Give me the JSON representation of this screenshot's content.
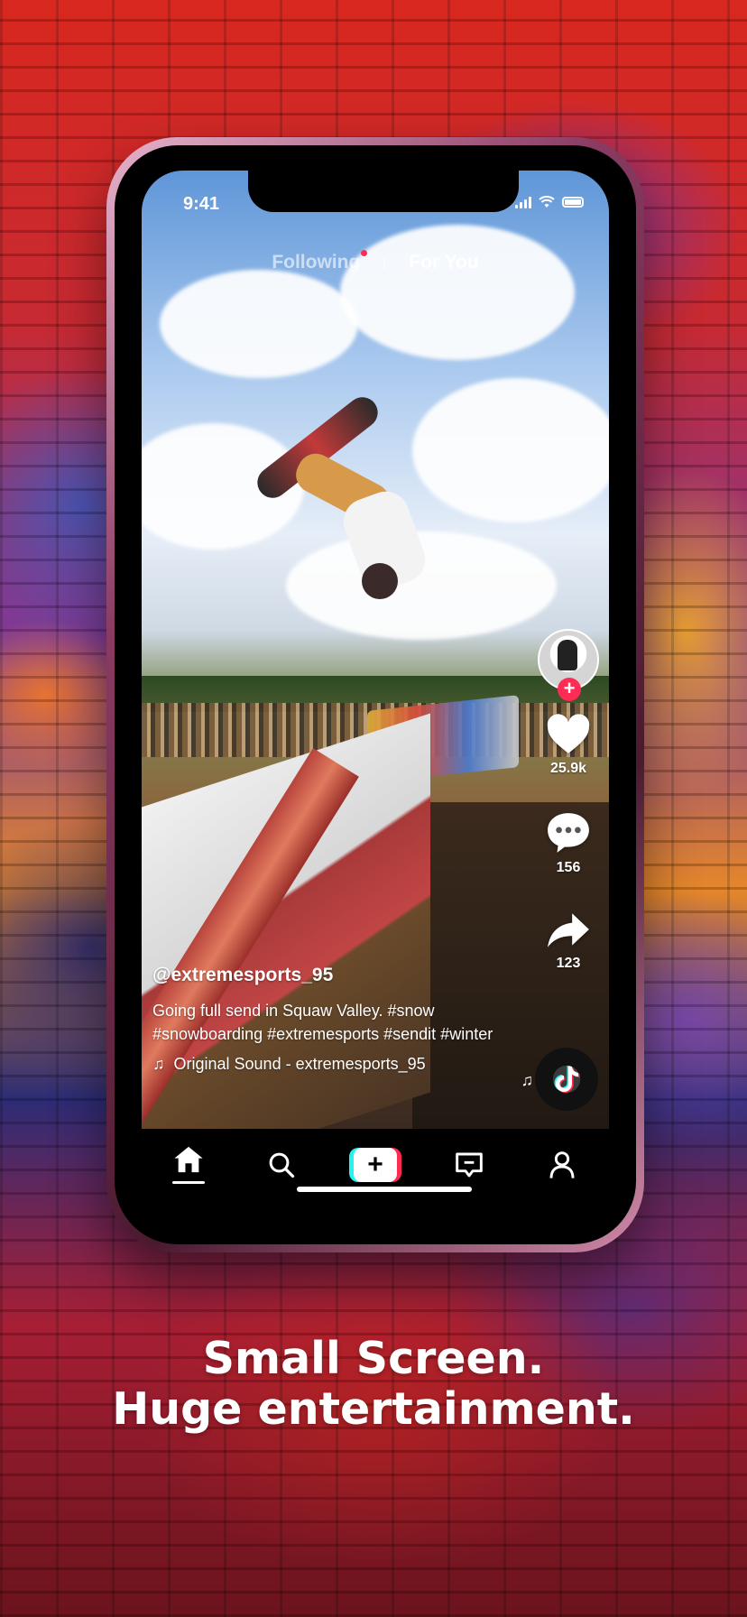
{
  "status_bar": {
    "time": "9:41"
  },
  "feed_tabs": {
    "following": "Following",
    "for_you": "For You"
  },
  "video": {
    "username": "@extremesports_95",
    "description": "Going full send in Squaw Valley. #snow #snowboarding #extremesports #sendit #winter",
    "sound": "Original Sound - extremesports_95"
  },
  "actions": {
    "likes": "25.9k",
    "comments": "156",
    "shares": "123"
  },
  "nav": {
    "items": [
      "home-icon",
      "search-icon",
      "create-icon",
      "inbox-icon",
      "profile-icon"
    ],
    "create_label": "+"
  },
  "tagline": {
    "line1": "Small Screen.",
    "line2": "Huge entertainment."
  },
  "colors": {
    "accent": "#fe2c55",
    "cyan": "#25f4ee"
  }
}
